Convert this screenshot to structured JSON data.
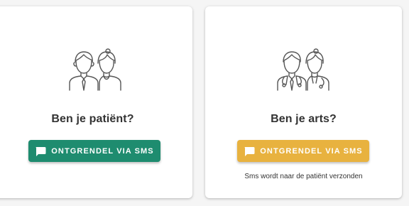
{
  "patient_card": {
    "heading": "Ben je patiënt?",
    "button_label": "ONTGRENDEL VIA SMS",
    "icon": "couple-people-icon",
    "button_color": "#1e8c6f"
  },
  "doctor_card": {
    "heading": "Ben je arts?",
    "button_label": "ONTGRENDEL VIA SMS",
    "note": "Sms wordt naar de patiënt verzonden",
    "icon": "doctors-icon",
    "button_color": "#e8b23f"
  },
  "icons": {
    "button_icon": "sms-message-icon"
  },
  "colors": {
    "background": "#f5f5f5",
    "card": "#ffffff",
    "text": "#333333",
    "icon_stroke": "#555555"
  }
}
